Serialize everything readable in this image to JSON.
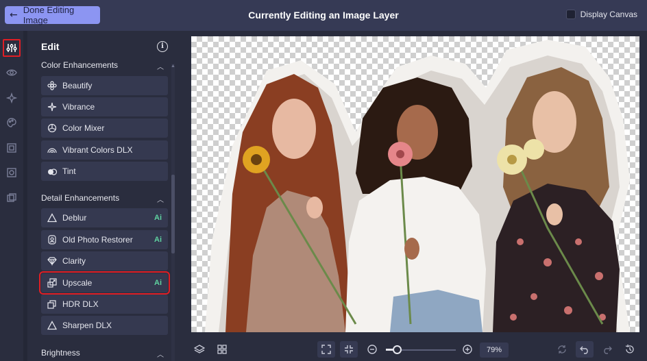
{
  "topbar": {
    "done_label": "Done Editing Image",
    "title": "Currently Editing an Image Layer",
    "display_canvas_label": "Display Canvas",
    "display_canvas_checked": false
  },
  "rail": {
    "items": [
      {
        "icon": "sliders-icon",
        "active": true
      },
      {
        "icon": "eye-icon",
        "active": false
      },
      {
        "icon": "sparkle-icon",
        "active": false
      },
      {
        "icon": "palette-icon",
        "active": false
      },
      {
        "icon": "frame-icon",
        "active": false
      },
      {
        "icon": "texture-icon",
        "active": false
      },
      {
        "icon": "overlay-icon",
        "active": false
      }
    ]
  },
  "panel": {
    "title": "Edit",
    "sections": [
      {
        "label": "Color Enhancements",
        "tools": [
          {
            "label": "Beautify",
            "icon": "flower-icon",
            "ai": ""
          },
          {
            "label": "Vibrance",
            "icon": "sparkle-icon",
            "ai": ""
          },
          {
            "label": "Color Mixer",
            "icon": "mixer-icon",
            "ai": ""
          },
          {
            "label": "Vibrant Colors DLX",
            "icon": "rainbow-icon",
            "ai": ""
          },
          {
            "label": "Tint",
            "icon": "tint-icon",
            "ai": ""
          }
        ]
      },
      {
        "label": "Detail Enhancements",
        "tools": [
          {
            "label": "Deblur",
            "icon": "triangle-icon",
            "ai": "Ai"
          },
          {
            "label": "Old Photo Restorer",
            "icon": "restore-icon",
            "ai": "Ai"
          },
          {
            "label": "Clarity",
            "icon": "diamond-icon",
            "ai": ""
          },
          {
            "label": "Upscale",
            "icon": "upscale-icon",
            "ai": "Ai",
            "highlighted": true
          },
          {
            "label": "HDR DLX",
            "icon": "hdr-icon",
            "ai": ""
          },
          {
            "label": "Sharpen DLX",
            "icon": "sharpen-icon",
            "ai": ""
          }
        ]
      },
      {
        "label": "Brightness",
        "tools": []
      }
    ]
  },
  "bottombar": {
    "zoom_label": "79%",
    "zoom_level": 0.16
  },
  "colors": {
    "accent": "#8c95f2",
    "highlight": "#e01e24",
    "ai_badge": "#5fd3a0"
  }
}
